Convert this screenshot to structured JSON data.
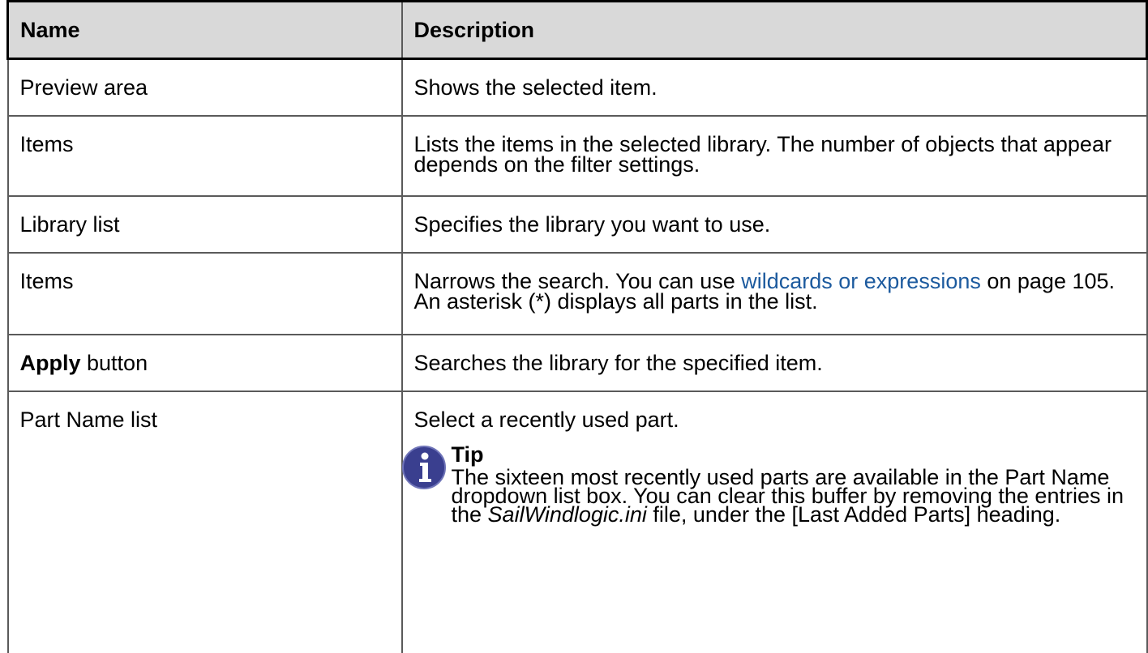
{
  "table": {
    "headers": {
      "name": "Name",
      "description": "Description"
    },
    "rows": [
      {
        "name": "Preview area",
        "description": "Shows the selected item."
      },
      {
        "name": "Items",
        "description": "Lists the items in the selected library. The number of objects that appear depends on the filter settings."
      },
      {
        "name": "Library list",
        "description": "Specifies the library you want to use."
      },
      {
        "name": "Items",
        "description_before": "Narrows the search. You can use ",
        "link": "wildcards or expressions",
        "description_after": " on page 105. An asterisk (*) displays all parts in the list."
      },
      {
        "name_bold": "Apply",
        "name_rest": " button",
        "description": "Searches the library for the specified item."
      },
      {
        "name": "Part Name list",
        "description": "Select a recently used part.",
        "tip": {
          "title": "Tip",
          "body_before": "The sixteen most recently used parts are available in the Part Name dropdown list box. You can clear this buffer by removing the entries in the ",
          "filename": "SailWindlogic.ini",
          "body_after": " file, under the [Last Added Parts] heading.",
          "icon": "info-icon",
          "icon_color": "#3a3f8f"
        }
      }
    ]
  },
  "colors": {
    "header_bg": "#d9d9d9",
    "link": "#1c5a9e",
    "border": "#5a5a5a"
  }
}
